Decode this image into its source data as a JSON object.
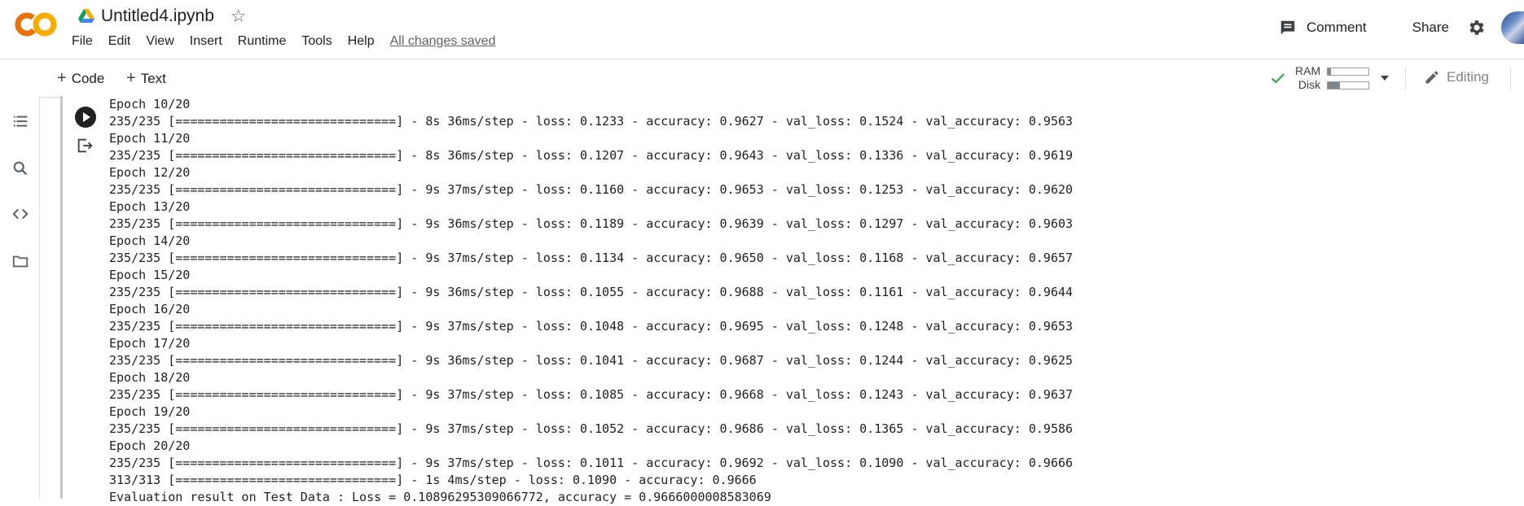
{
  "app": {
    "file_name": "Untitled4.ipynb",
    "saved_status": "All changes saved"
  },
  "menu": [
    "File",
    "Edit",
    "View",
    "Insert",
    "Runtime",
    "Tools",
    "Help"
  ],
  "header": {
    "comment_label": "Comment",
    "share_label": "Share"
  },
  "toolbar": {
    "code_label": "Code",
    "text_label": "Text",
    "ram_label": "RAM",
    "disk_label": "Disk",
    "ram_usage": 0.08,
    "disk_usage": 0.3,
    "editing_label": "Editing"
  },
  "colors": {
    "logo_orange": "#F9AB00",
    "logo_orange_dark": "#E8710A",
    "connected_green": "#34A853"
  },
  "icons": {
    "sidebar": [
      "toc-icon",
      "search-icon",
      "code-snippets-icon",
      "folder-icon"
    ]
  },
  "output": {
    "lines": [
      "Epoch 10/20",
      "235/235 [==============================] - 8s 36ms/step - loss: 0.1233 - accuracy: 0.9627 - val_loss: 0.1524 - val_accuracy: 0.9563",
      "Epoch 11/20",
      "235/235 [==============================] - 8s 36ms/step - loss: 0.1207 - accuracy: 0.9643 - val_loss: 0.1336 - val_accuracy: 0.9619",
      "Epoch 12/20",
      "235/235 [==============================] - 9s 37ms/step - loss: 0.1160 - accuracy: 0.9653 - val_loss: 0.1253 - val_accuracy: 0.9620",
      "Epoch 13/20",
      "235/235 [==============================] - 9s 36ms/step - loss: 0.1189 - accuracy: 0.9639 - val_loss: 0.1297 - val_accuracy: 0.9603",
      "Epoch 14/20",
      "235/235 [==============================] - 9s 37ms/step - loss: 0.1134 - accuracy: 0.9650 - val_loss: 0.1168 - val_accuracy: 0.9657",
      "Epoch 15/20",
      "235/235 [==============================] - 9s 36ms/step - loss: 0.1055 - accuracy: 0.9688 - val_loss: 0.1161 - val_accuracy: 0.9644",
      "Epoch 16/20",
      "235/235 [==============================] - 9s 37ms/step - loss: 0.1048 - accuracy: 0.9695 - val_loss: 0.1248 - val_accuracy: 0.9653",
      "Epoch 17/20",
      "235/235 [==============================] - 9s 36ms/step - loss: 0.1041 - accuracy: 0.9687 - val_loss: 0.1244 - val_accuracy: 0.9625",
      "Epoch 18/20",
      "235/235 [==============================] - 9s 37ms/step - loss: 0.1085 - accuracy: 0.9668 - val_loss: 0.1243 - val_accuracy: 0.9637",
      "Epoch 19/20",
      "235/235 [==============================] - 9s 37ms/step - loss: 0.1052 - accuracy: 0.9686 - val_loss: 0.1365 - val_accuracy: 0.9586",
      "Epoch 20/20",
      "235/235 [==============================] - 9s 37ms/step - loss: 0.1011 - accuracy: 0.9692 - val_loss: 0.1090 - val_accuracy: 0.9666",
      "313/313 [==============================] - 1s 4ms/step - loss: 0.1090 - accuracy: 0.9666",
      "Evaluation result on Test Data : Loss = 0.10896295309066772, accuracy = 0.9666000008583069"
    ]
  }
}
